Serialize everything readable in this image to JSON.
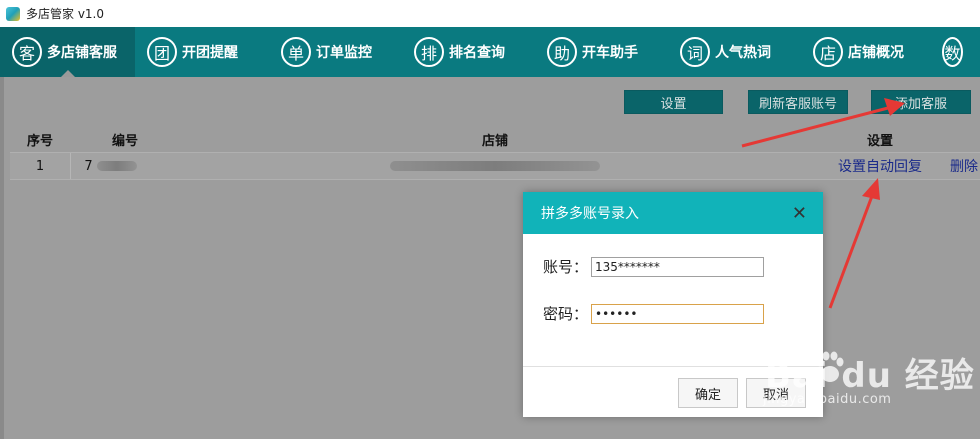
{
  "window": {
    "title": "多店管家 v1.0"
  },
  "nav": {
    "items": [
      {
        "glyph": "客",
        "label": "多店铺客服",
        "active": true
      },
      {
        "glyph": "团",
        "label": "开团提醒"
      },
      {
        "glyph": "单",
        "label": "订单监控"
      },
      {
        "glyph": "排",
        "label": "排名查询"
      },
      {
        "glyph": "助",
        "label": "开车助手"
      },
      {
        "glyph": "词",
        "label": "人气热词"
      },
      {
        "glyph": "店",
        "label": "店铺概况"
      },
      {
        "glyph": "数",
        "label": ""
      }
    ]
  },
  "toolbar": {
    "settings_label": "设置",
    "refresh_label": "刷新客服账号",
    "add_label": "添加客服"
  },
  "table": {
    "columns": [
      "序号",
      "编号",
      "店铺",
      "设置"
    ],
    "rows": [
      {
        "index": "1",
        "id_visible": "7",
        "action_label": "设置自动回复",
        "delete_label": "删除"
      }
    ]
  },
  "dialog": {
    "title": "拼多多账号录入",
    "account_label": "账号：",
    "account_value": "135*******",
    "password_label": "密码：",
    "password_value": "••••••",
    "confirm_label": "确定",
    "cancel_label": "取消"
  },
  "watermark": {
    "brand": "Bai  du 经验",
    "url": "jingyan.baidu.com"
  },
  "colors": {
    "nav_bg": "#0a7a80",
    "dialog_header": "#11b3b9",
    "annotation_arrow": "#e53935"
  }
}
